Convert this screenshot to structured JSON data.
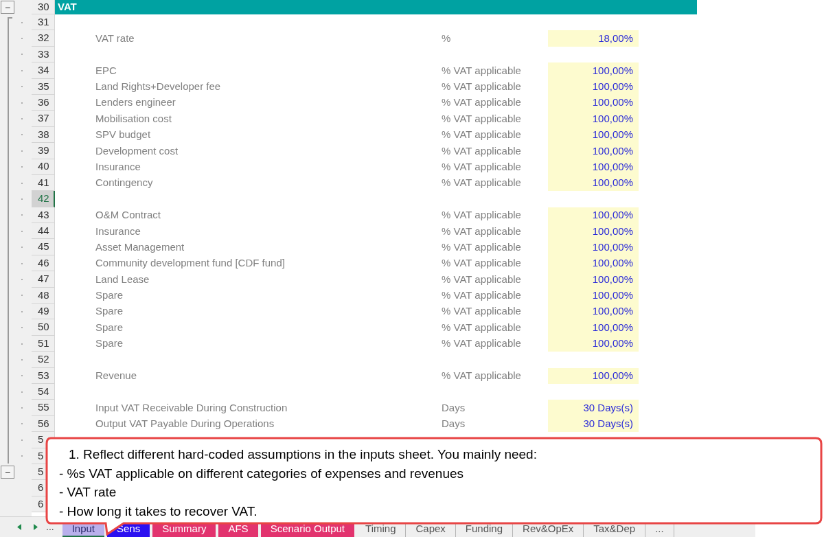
{
  "section_title": "VAT",
  "rows": [
    {
      "number": "30",
      "kind": "header",
      "selected": false,
      "dotted": false,
      "toggle": "−"
    },
    {
      "number": "31",
      "kind": "blank",
      "selected": false,
      "dotted": true
    },
    {
      "number": "32",
      "kind": "input",
      "selected": false,
      "dotted": true,
      "label": "VAT rate",
      "unit": "%",
      "value": "18,00%"
    },
    {
      "number": "33",
      "kind": "blank",
      "selected": false,
      "dotted": true
    },
    {
      "number": "34",
      "kind": "input",
      "selected": false,
      "dotted": true,
      "label": "EPC",
      "unit": "% VAT applicable",
      "value": "100,00%"
    },
    {
      "number": "35",
      "kind": "input",
      "selected": false,
      "dotted": true,
      "label": "Land Rights+Developer fee",
      "unit": "% VAT applicable",
      "value": "100,00%"
    },
    {
      "number": "36",
      "kind": "input",
      "selected": false,
      "dotted": true,
      "label": "Lenders engineer",
      "unit": "% VAT applicable",
      "value": "100,00%"
    },
    {
      "number": "37",
      "kind": "input",
      "selected": false,
      "dotted": true,
      "label": "Mobilisation cost",
      "unit": "% VAT applicable",
      "value": "100,00%"
    },
    {
      "number": "38",
      "kind": "input",
      "selected": false,
      "dotted": true,
      "label": "SPV budget",
      "unit": "% VAT applicable",
      "value": "100,00%"
    },
    {
      "number": "39",
      "kind": "input",
      "selected": false,
      "dotted": true,
      "label": "Development cost",
      "unit": "% VAT applicable",
      "value": "100,00%"
    },
    {
      "number": "40",
      "kind": "input",
      "selected": false,
      "dotted": true,
      "label": "Insurance",
      "unit": "% VAT applicable",
      "value": "100,00%"
    },
    {
      "number": "41",
      "kind": "input",
      "selected": false,
      "dotted": true,
      "label": "Contingency",
      "unit": "% VAT applicable",
      "value": "100,00%"
    },
    {
      "number": "42",
      "kind": "blank",
      "selected": true,
      "dotted": true
    },
    {
      "number": "43",
      "kind": "input",
      "selected": false,
      "dotted": true,
      "label": "O&M Contract",
      "unit": "% VAT applicable",
      "value": "100,00%"
    },
    {
      "number": "44",
      "kind": "input",
      "selected": false,
      "dotted": true,
      "label": "Insurance",
      "unit": "% VAT applicable",
      "value": "100,00%"
    },
    {
      "number": "45",
      "kind": "input",
      "selected": false,
      "dotted": true,
      "label": "Asset Management",
      "unit": "% VAT applicable",
      "value": "100,00%"
    },
    {
      "number": "46",
      "kind": "input",
      "selected": false,
      "dotted": true,
      "label": "Community development fund [CDF fund]",
      "unit": "% VAT applicable",
      "value": "100,00%"
    },
    {
      "number": "47",
      "kind": "input",
      "selected": false,
      "dotted": true,
      "label": "Land Lease",
      "unit": "% VAT applicable",
      "value": "100,00%"
    },
    {
      "number": "48",
      "kind": "input",
      "selected": false,
      "dotted": true,
      "label": "Spare",
      "unit": "% VAT applicable",
      "value": "100,00%"
    },
    {
      "number": "49",
      "kind": "input",
      "selected": false,
      "dotted": true,
      "label": "Spare",
      "unit": "% VAT applicable",
      "value": "100,00%"
    },
    {
      "number": "50",
      "kind": "input",
      "selected": false,
      "dotted": true,
      "label": "Spare",
      "unit": "% VAT applicable",
      "value": "100,00%"
    },
    {
      "number": "51",
      "kind": "input",
      "selected": false,
      "dotted": true,
      "label": "Spare",
      "unit": "% VAT applicable",
      "value": "100,00%"
    },
    {
      "number": "52",
      "kind": "blank",
      "selected": false,
      "dotted": true
    },
    {
      "number": "53",
      "kind": "input",
      "selected": false,
      "dotted": true,
      "label": "Revenue",
      "unit": "% VAT applicable",
      "value": "100,00%"
    },
    {
      "number": "54",
      "kind": "blank",
      "selected": false,
      "dotted": true
    },
    {
      "number": "55",
      "kind": "input",
      "selected": false,
      "dotted": true,
      "label": "Input VAT Receivable During Construction",
      "unit": "Days",
      "value": "30 Days(s)"
    },
    {
      "number": "56",
      "kind": "input",
      "selected": false,
      "dotted": true,
      "label": "Output VAT Payable During Operations",
      "unit": "Days",
      "value": "30 Days(s)"
    },
    {
      "number": "5",
      "kind": "blank",
      "selected": false,
      "dotted": true
    },
    {
      "number": "5",
      "kind": "blank",
      "selected": false,
      "dotted": true
    },
    {
      "number": "5",
      "kind": "blank",
      "selected": false,
      "dotted": false,
      "toggle": "−"
    },
    {
      "number": "6",
      "kind": "blank",
      "selected": false,
      "dotted": false
    },
    {
      "number": "6",
      "kind": "blank",
      "selected": false,
      "dotted": false
    }
  ],
  "callout": {
    "lines": [
      "1. Reflect different hard-coded assumptions in the inputs sheet. You mainly need:",
      "- %s VAT applicable on different categories of expenses and revenues",
      "- VAT rate",
      "- How long it takes to recover VAT."
    ]
  },
  "sheet_nav": {
    "more": "..."
  },
  "tabs": [
    {
      "label": "Input",
      "selected": true,
      "color": "#b9b0ec"
    },
    {
      "label": "Sens",
      "selected": false,
      "color": "#2b10f0"
    },
    {
      "label": "Summary",
      "selected": false,
      "color": "#e2336e"
    },
    {
      "label": "AFS",
      "selected": false,
      "color": "#e2336e"
    },
    {
      "label": "Scenario Output",
      "selected": false,
      "color": "#e2336e"
    },
    {
      "label": "Timing",
      "selected": false
    },
    {
      "label": "Capex",
      "selected": false
    },
    {
      "label": "Funding",
      "selected": false
    },
    {
      "label": "Rev&OpEx",
      "selected": false
    },
    {
      "label": "Tax&Dep",
      "selected": false
    },
    {
      "label": "...",
      "selected": false
    }
  ]
}
